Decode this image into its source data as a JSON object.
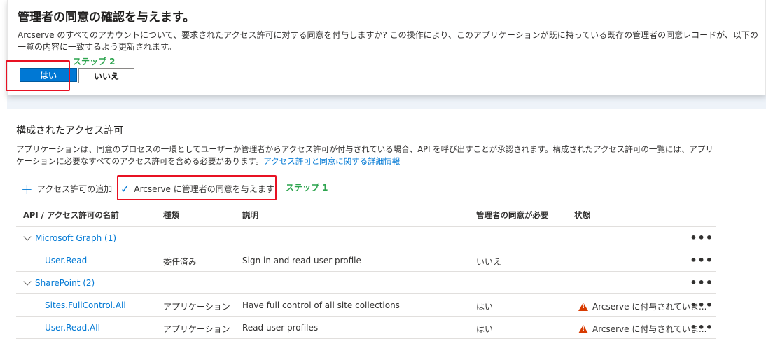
{
  "dialog": {
    "title": "管理者の同意の確認を与えます。",
    "message": "Arcserve のすべてのアカウントについて、要求されたアクセス許可に対する同意を付与しますか? この操作により、このアプリケーションが既に持っている既存の管理者の同意レコードが、以下の一覧の内容に一致するよう更新されます。",
    "yes_label": "はい",
    "no_label": "いいえ",
    "step2_label": "ステップ 2"
  },
  "section": {
    "title": "構成されたアクセス許可",
    "description": "アプリケーションは、同意のプロセスの一環としてユーザーか管理者からアクセス許可が付与されている場合、API を呼び出すことが承認されます。構成されたアクセス許可の一覧には、アプリケーションに必要なすべてのアクセス許可を含める必要があります。",
    "link_text": "アクセス許可と同意に関する詳細情報"
  },
  "toolbar": {
    "add_label": "アクセス許可の追加",
    "grant_label": "Arcserve に管理者の同意を与えます",
    "step1_label": "ステップ 1"
  },
  "table": {
    "headers": {
      "name": "API / アクセス許可の名前",
      "type": "種類",
      "description": "説明",
      "admin_consent": "管理者の同意が必要",
      "status": "状態"
    },
    "groups": [
      {
        "label": "Microsoft Graph (1)",
        "rows": [
          {
            "name": "User.Read",
            "type": "委任済み",
            "description": "Sign in and read user profile",
            "admin_consent": "いいえ",
            "status": ""
          }
        ]
      },
      {
        "label": "SharePoint (2)",
        "rows": [
          {
            "name": "Sites.FullControl.All",
            "type": "アプリケーション",
            "description": "Have full control of all site collections",
            "admin_consent": "はい",
            "status": "Arcserve に付与されていま..."
          },
          {
            "name": "User.Read.All",
            "type": "アプリケーション",
            "description": "Read user profiles",
            "admin_consent": "はい",
            "status": "Arcserve に付与されていま..."
          }
        ]
      }
    ],
    "more_label": "•••"
  },
  "colors": {
    "accent": "#0078d4",
    "highlight": "#e81123",
    "step": "#2da44e",
    "warning": "#d83b01"
  }
}
